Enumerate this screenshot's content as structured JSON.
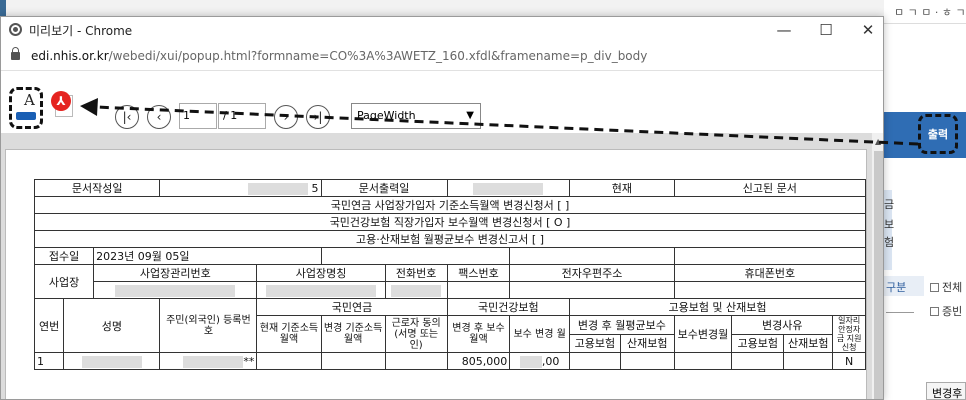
{
  "window": {
    "title": "미리보기 - Chrome",
    "url_host": "edi.nhis.or.kr",
    "url_path": "/webedi/xui/popup.html?formname=CO%3A%3AWETZ_160.xfdl&framename=p_div_body",
    "minimize": "—",
    "maximize": "☐",
    "close": "✕"
  },
  "toolbar": {
    "font_glyph": "A",
    "pdf_glyph": "⅄",
    "first_page": "|‹",
    "prev_page": "‹",
    "page_current": "1",
    "page_total": "/ 1",
    "next_page": "›",
    "last_page": "›|",
    "zoom_selected": "PageWidth"
  },
  "background_page": {
    "top_text": "ㅁ ㄱ ㅁ · ㅎ ㄱ ㄱ",
    "print_label": "출력",
    "gubun_label": "구분",
    "check_all": "전체",
    "check_cert": "증빈",
    "side_letters": [
      "금",
      "보",
      "험"
    ],
    "change_label": "변경후"
  },
  "report": {
    "doc_created_label": "문서작성일",
    "doc_created_value": "5",
    "doc_printed_label": "문서출력일",
    "current_label": "현재",
    "reported_doc_label": "신고된 문서",
    "title1": "국민연금 사업장가입자 기준소득월액 변경신청서 [   ]",
    "title2": "국민건강보험 직장가입자 보수월액 변경신청서 [ O ]",
    "title3": "고용·산재보험 월평균보수 변경신고서 [   ]",
    "received_label": "접수일",
    "received_value": "2023년 09월 05일",
    "workplace_label": "사업장",
    "workplace_cols": [
      "사업장관리번호",
      "사업장명칭",
      "전화번호",
      "팩스번호",
      "전자우편주소",
      "휴대폰번호"
    ],
    "header": {
      "seq": "연번",
      "name": "성명",
      "rrn": "주민(외국인) 등록번호",
      "pension": "국민연금",
      "pension_cur": "현재 기준소득월액",
      "pension_new": "변경 기준소득월액",
      "pension_consent": "근로자 동의 (서명 또는 인)",
      "health": "국민건강보험",
      "health_new": "변경 후 보수월액",
      "health_month": "보수 변경 월",
      "employ": "고용보험 및 산재보험",
      "employ_avg": "변경 후 월평균보수",
      "employ_ins": "고용보험",
      "industrial_ins": "산재보험",
      "employ_month": "보수변경월",
      "reason": "변경사유",
      "reason_employ": "고용보험",
      "reason_industrial": "산재보험",
      "extra": "일자리 안정자금 지원 신청"
    },
    "row1": {
      "seq": "1",
      "rrn_suffix": "**",
      "health_new": "805,000",
      "health_month_suffix": ",00",
      "extra": "N"
    }
  }
}
